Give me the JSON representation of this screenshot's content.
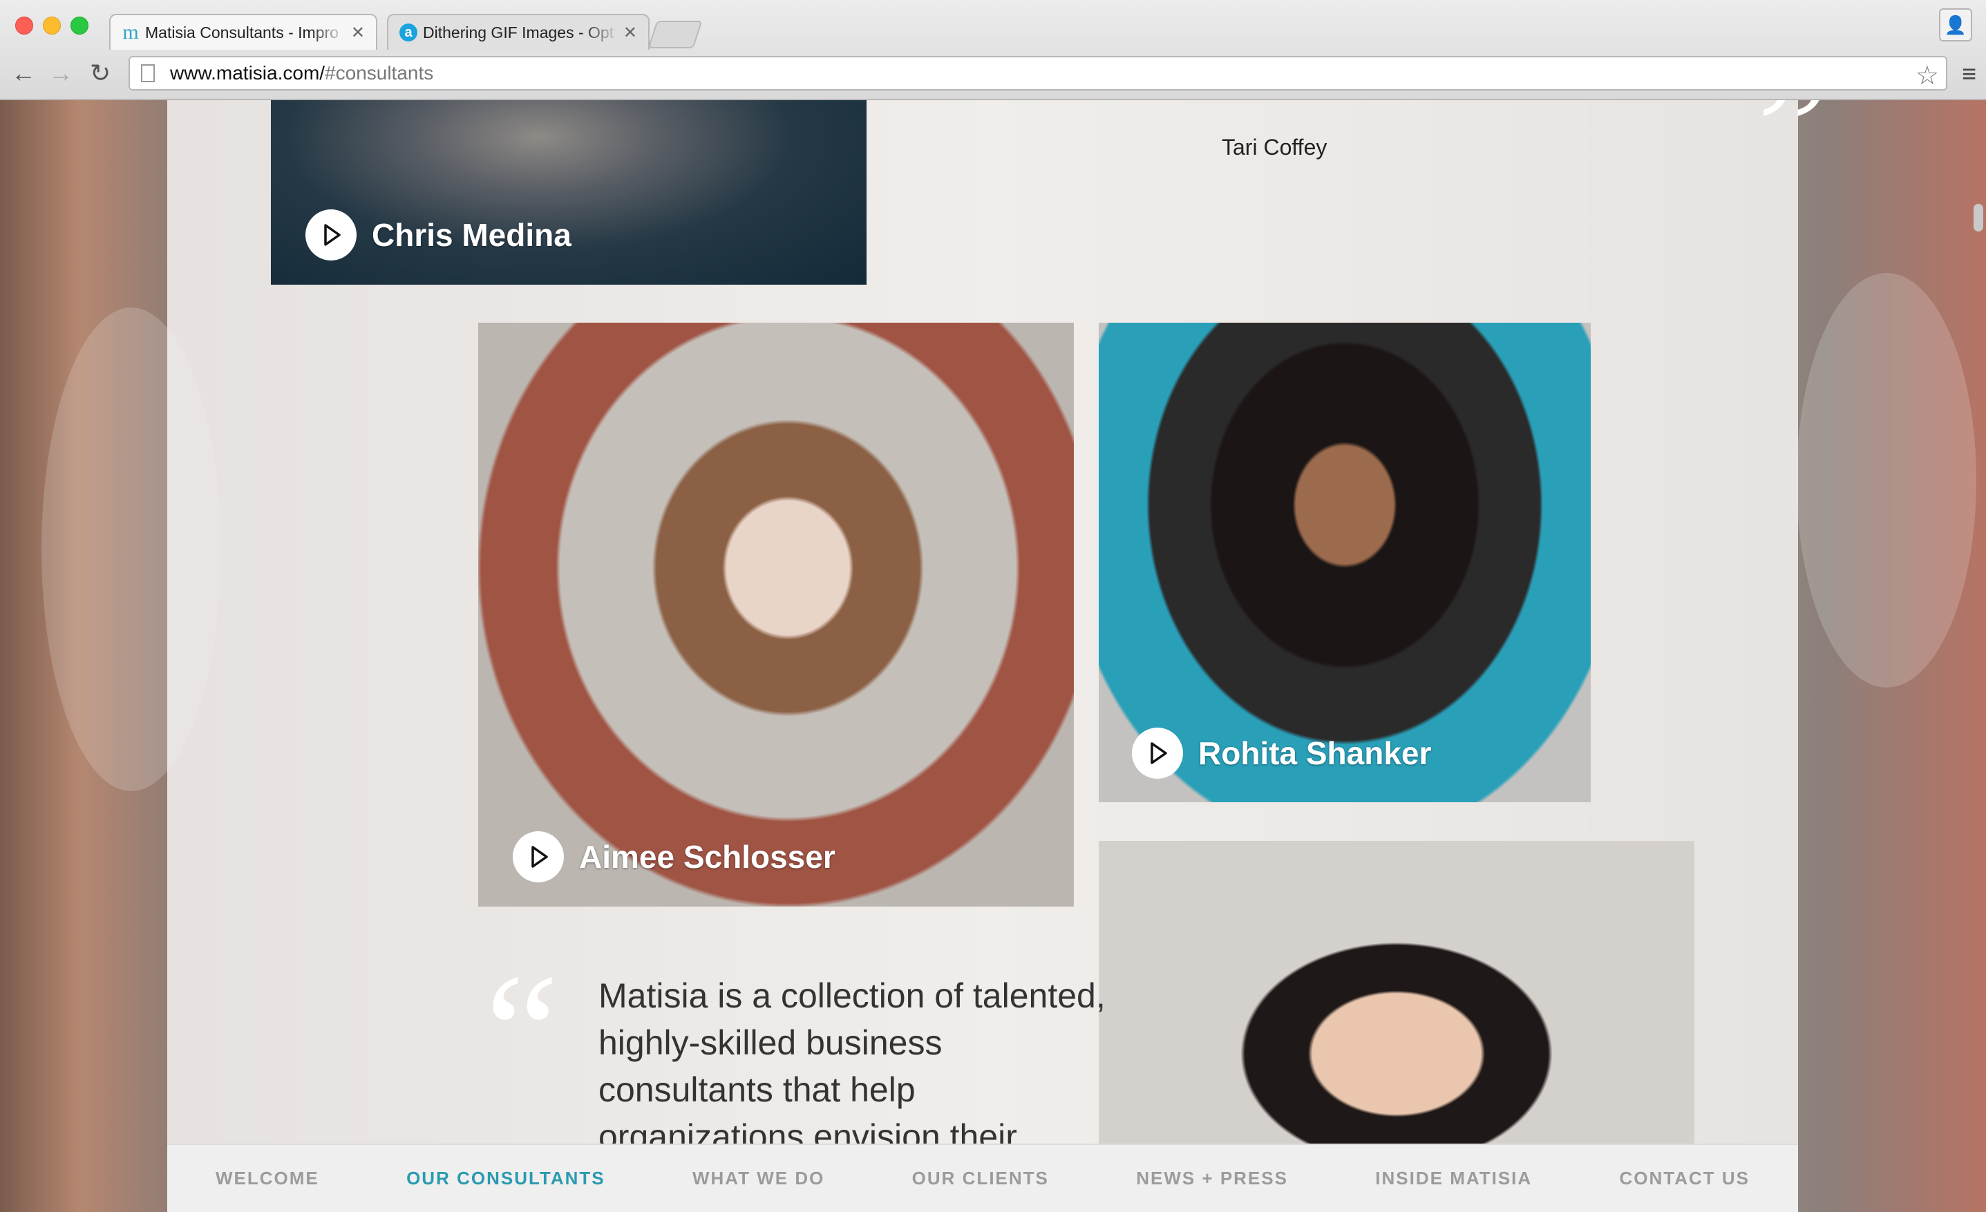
{
  "browser": {
    "tabs": [
      {
        "title": "Matisia Consultants - Impro",
        "favicon": "matisia-m-icon",
        "active": true
      },
      {
        "title": "Dithering GIF Images - Opt",
        "favicon": "a-icon",
        "active": false
      }
    ],
    "url": {
      "host": "www.matisia.com/",
      "path": "#consultants"
    }
  },
  "page": {
    "testimonial_attribution": "Tari Coffey",
    "consultants": [
      {
        "name": "Chris Medina"
      },
      {
        "name": "Aimee Schlosser"
      },
      {
        "name": "Rohita Shanker"
      }
    ],
    "quote": {
      "mark": "“",
      "close_mark": "”",
      "text": "Matisia is a collection of talented, highly-skilled business consultants that help organizations envision their"
    },
    "nav": [
      {
        "label": "WELCOME",
        "active": false
      },
      {
        "label": "OUR CONSULTANTS",
        "active": true
      },
      {
        "label": "WHAT WE DO",
        "active": false
      },
      {
        "label": "OUR CLIENTS",
        "active": false
      },
      {
        "label": "NEWS + PRESS",
        "active": false
      },
      {
        "label": "INSIDE MATISIA",
        "active": false
      },
      {
        "label": "CONTACT US",
        "active": false
      }
    ]
  },
  "colors": {
    "accent": "#2b9ab0",
    "nav_inactive": "#9b9b9b",
    "quote_mark": "#ffffff"
  }
}
